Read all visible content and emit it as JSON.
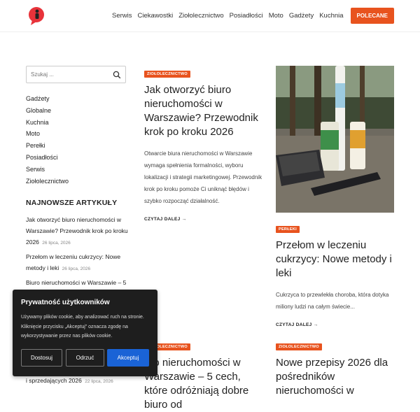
{
  "header": {
    "nav": [
      "Serwis",
      "Ciekawostki",
      "Ziołolecznictwo",
      "Posiadłości",
      "Moto",
      "Gadżety",
      "Kuchnia"
    ],
    "cta": "POLECANE",
    "colors": {
      "accent": "#e8531e"
    }
  },
  "sidebar": {
    "search_placeholder": "Szukaj ...",
    "categories": [
      "Gadżety",
      "Globalne",
      "Kuchnia",
      "Moto",
      "Perełki",
      "Posiadłości",
      "Serwis",
      "Ziołolecznictwo"
    ],
    "latest_heading": "NAJNOWSZE ARTYKUŁY",
    "latest": [
      {
        "title": "Jak otworzyć biuro nieruchomości w Warszawie? Przewodnik krok po kroku 2026",
        "date": "26 lipca, 2026"
      },
      {
        "title": "Przełom w leczeniu cukrzycy: Nowe metody i leki",
        "date": "26 lipca, 2026"
      },
      {
        "title": "Biuro nieruchomości w Warszawie – 5",
        "date": ""
      }
    ],
    "partial_item": {
      "title": "i sprzedających 2026",
      "date": "22 lipca, 2026"
    }
  },
  "articles": [
    {
      "tag": "ZIOŁOLECZNICTWO",
      "title": "Jak otworzyć biuro nieruchomości w Warszawie? Przewodnik krok po kroku 2026",
      "excerpt": "Otwarcie biura nieruchomości w Warszawie wymaga spełnienia formalności, wyboru lokalizacji i strategii marketingowej. Przewodnik krok po kroku pomoże Ci uniknąć błędów i szybko rozpocząć działalność.",
      "more": "CZYTAJ DALEJ →"
    },
    {
      "tag": "PERŁEKI",
      "title": "Przełom w leczeniu cukrzycy: Nowe metody i leki",
      "excerpt": "Cukrzyca to przewlekła choroba, która dotyka miliony ludzi na całym świecie...",
      "more": "CZYTAJ DALEJ →"
    },
    {
      "tag": "ZIOŁOLECZNICTWO",
      "title": "uro nieruchomości w Warszawie – 5 cech, które odróżniają dobre biuro od"
    },
    {
      "tag": "ZIOŁOLECZNICTWO",
      "title": "Nowe przepisy 2026 dla pośredników nieruchomości w"
    }
  ],
  "cookie": {
    "title": "Prywatność użytkowników",
    "text": "Używamy plików cookie, aby analizować ruch na stronie. Kliknięcie przycisku „Akceptuj” oznacza zgodę na wykorzystywanie przez nas plików cookie.",
    "buttons": [
      "Dostosuj",
      "Odrzuć",
      "Akceptuj"
    ]
  }
}
